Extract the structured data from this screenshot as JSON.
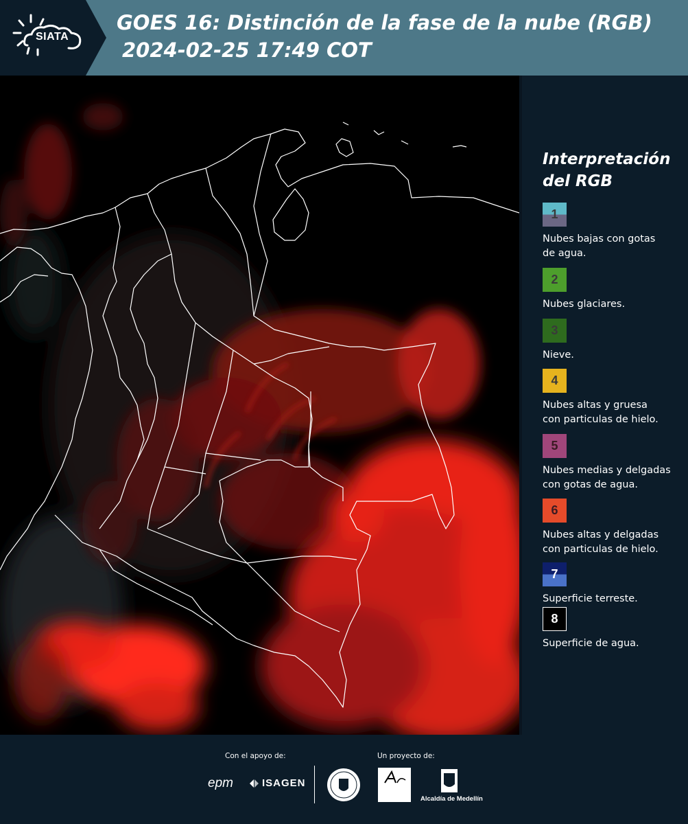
{
  "header": {
    "logo_text": "SIATA",
    "title": "GOES 16: Distinción de la fase de la nube (RGB)",
    "subtitle": "2024-02-25 17:49 COT",
    "bg_color": "#4d7888",
    "logo_bg_color": "#0c1c29"
  },
  "legend": {
    "title_line1": "Interpretación",
    "title_line2": "del RGB",
    "items": [
      {
        "number": "1",
        "label_line1": "Nubes bajas con gotas",
        "label_line2": "de agua.",
        "color_top": "#5fb9c8",
        "color_bottom": "#6b6784"
      },
      {
        "number": "2",
        "label_line1": "Nubes glaciares.",
        "label_line2": "",
        "color_top": "#4d9e2c",
        "color_bottom": "#4d9e2c"
      },
      {
        "number": "3",
        "label_line1": "Nieve.",
        "label_line2": "",
        "color_top": "#2e6b1e",
        "color_bottom": "#2e6b1e"
      },
      {
        "number": "4",
        "label_line1": "Nubes altas y gruesa",
        "label_line2": "con particulas de hielo.",
        "color_top": "#e6b31e",
        "color_bottom": "#e6b31e"
      },
      {
        "number": "5",
        "label_line1": "Nubes medias y delgadas",
        "label_line2": "con gotas de agua.",
        "color_top": "#a0467a",
        "color_bottom": "#a0467a"
      },
      {
        "number": "6",
        "label_line1": "Nubes altas y delgadas",
        "label_line2": "con particulas de hielo.",
        "color_top": "#e54b2a",
        "color_bottom": "#e54b2a"
      },
      {
        "number": "7",
        "label_line1": "Superficie terreste.",
        "label_line2": "",
        "color_top": "#0e1f6b",
        "color_bottom": "#4a72c8"
      },
      {
        "number": "8",
        "label_line1": "Superficie de agua.",
        "label_line2": "",
        "color_top": "#000000",
        "color_bottom": "#000000"
      }
    ]
  },
  "footer": {
    "support_label": "Con el apoyo de:",
    "project_label": "Un proyecto de:",
    "epm": "epm",
    "isagen": "ISAGEN",
    "alcaldia": "Alcaldía de Medellín"
  }
}
